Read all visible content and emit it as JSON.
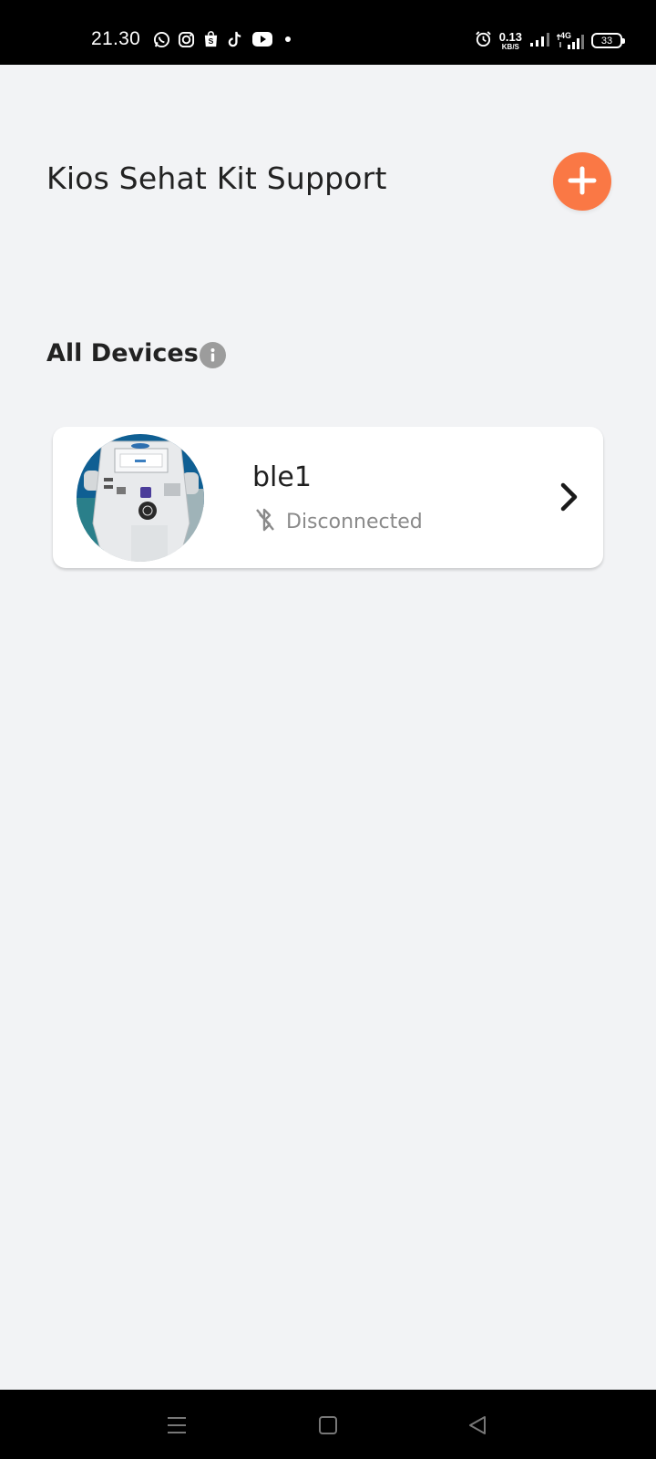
{
  "status_bar": {
    "time": "21.30",
    "app_icons": [
      "whatsapp-icon",
      "instagram-icon",
      "shopee-icon",
      "tiktok-icon",
      "youtube-icon",
      "dot-icon"
    ],
    "net_speed_value": "0.13",
    "net_speed_unit": "KB/S",
    "network_label": "4G",
    "battery_level": "33"
  },
  "header": {
    "title": "Kios Sehat Kit Support",
    "add_icon": "plus-icon"
  },
  "section": {
    "title": "All Devices",
    "info_icon": "info-icon"
  },
  "devices": [
    {
      "name": "ble1",
      "status": "Disconnected",
      "status_icon": "bluetooth-disabled-icon",
      "action_icon": "chevron-right-icon"
    }
  ],
  "nav_bar": {
    "buttons": [
      "menu-icon",
      "home-icon",
      "back-icon"
    ]
  },
  "colors": {
    "background": "#f2f3f5",
    "accent": "#fa7845",
    "card": "#ffffff",
    "muted_text": "#8a8a8a"
  }
}
